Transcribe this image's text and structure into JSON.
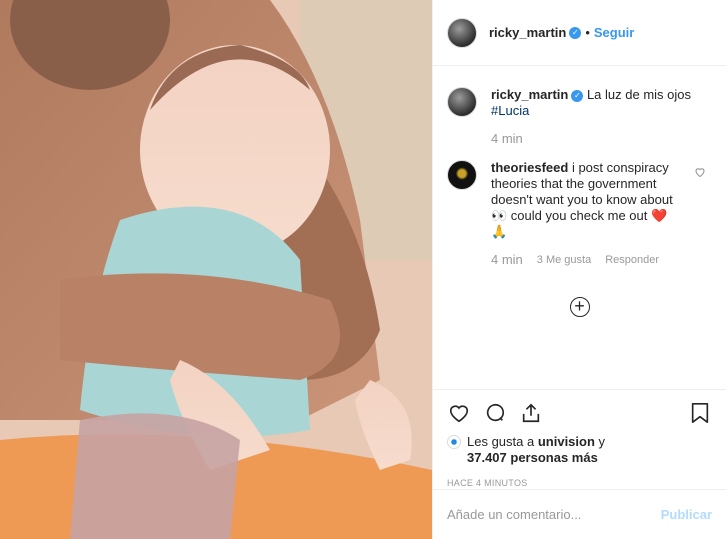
{
  "post": {
    "author": "ricky_martin",
    "follow_label": "Seguir",
    "separator": "•",
    "caption_text": "La luz de mis ojos",
    "caption_hashtag": "#Lucia",
    "caption_time": "4 min"
  },
  "comment": {
    "user": "theoriesfeed",
    "text": "i post conspiracy theories that the government doesn't want you to know about 👀 could you check me out ❤️ 🙏",
    "time": "4 min",
    "likes": "3 Me gusta",
    "reply_label": "Responder"
  },
  "likes": {
    "prefix": "Les gusta a",
    "user": "univision",
    "suffix": "y",
    "others": "37.407 personas más"
  },
  "timestamp": "HACE 4 MINUTOS",
  "add_comment": {
    "placeholder": "Añade un comentario...",
    "publish_label": "Publicar"
  },
  "icons": {
    "verified": "verified-badge-icon",
    "like": "heart-icon",
    "comment": "comment-bubble-icon",
    "share": "share-icon",
    "save": "bookmark-icon",
    "load_more": "plus-circle-icon"
  },
  "colors": {
    "link": "#3897f0",
    "hashtag": "#003569",
    "publish_disabled": "#b3dbff"
  }
}
